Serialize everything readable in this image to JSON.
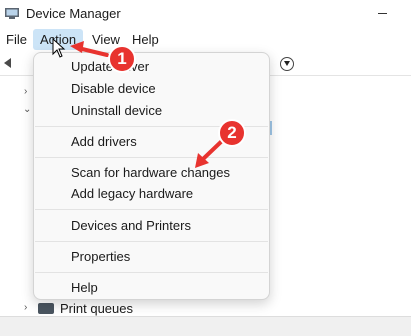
{
  "window": {
    "title": "Device Manager"
  },
  "menubar": {
    "file": "File",
    "action": "Action",
    "view": "View",
    "help": "Help"
  },
  "context_menu": {
    "items": [
      "Update driver",
      "Disable device",
      "Uninstall device",
      "Add drivers",
      "Scan for hardware changes",
      "Add legacy hardware",
      "Devices and Printers",
      "Properties",
      "Help"
    ]
  },
  "tree": {
    "print_queues": "Print queues"
  },
  "annotations": {
    "badge1": "1",
    "badge2": "2",
    "color": "#e8332f"
  }
}
